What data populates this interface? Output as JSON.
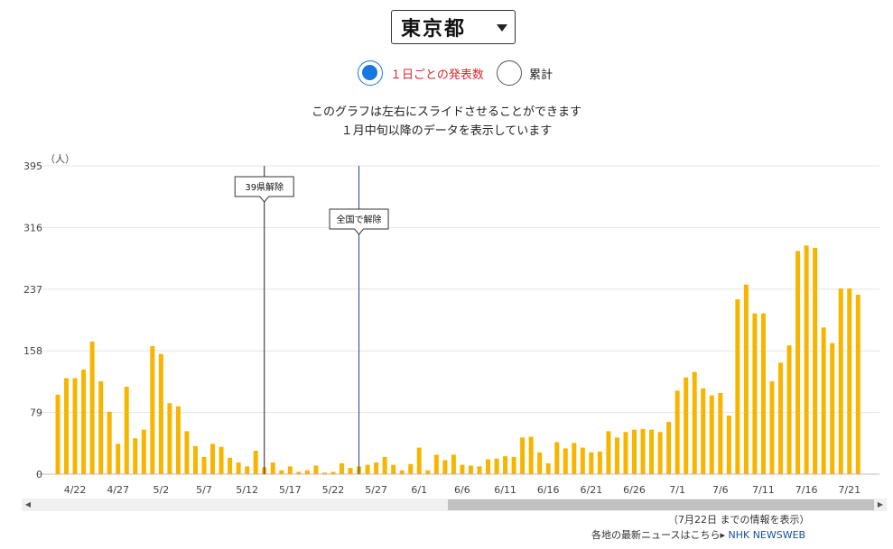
{
  "selector": {
    "value": "東京都"
  },
  "view_mode": {
    "options": [
      {
        "label": "１日ごとの発表数",
        "selected": true
      },
      {
        "label": "累計",
        "selected": false
      }
    ]
  },
  "notes": {
    "line1": "このグラフは左右にスライドさせることができます",
    "line2": "１月中旬以降のデータを表示しています"
  },
  "footer": {
    "info_date": "（7月22日 までの情報を表示）",
    "news_text": "各地の最新ニュースはこちら▸",
    "news_link": "NHK NEWSWEB"
  },
  "colors": {
    "bar": "#f8b500",
    "accent": "#1677e0",
    "selected_label": "#d9262c"
  },
  "chart_data": {
    "type": "bar",
    "unit_label": "（人）",
    "ylim": [
      0,
      395
    ],
    "yticks": [
      0,
      79,
      158,
      237,
      316,
      395
    ],
    "grid": true,
    "x": [
      "4/20",
      "4/21",
      "4/22",
      "4/23",
      "4/24",
      "4/25",
      "4/26",
      "4/27",
      "4/28",
      "4/29",
      "4/30",
      "5/1",
      "5/2",
      "5/3",
      "5/4",
      "5/5",
      "5/6",
      "5/7",
      "5/8",
      "5/9",
      "5/10",
      "5/11",
      "5/12",
      "5/13",
      "5/14",
      "5/15",
      "5/16",
      "5/17",
      "5/18",
      "5/19",
      "5/20",
      "5/21",
      "5/22",
      "5/23",
      "5/24",
      "5/25",
      "5/26",
      "5/27",
      "5/28",
      "5/29",
      "5/30",
      "5/31",
      "6/1",
      "6/2",
      "6/3",
      "6/4",
      "6/5",
      "6/6",
      "6/7",
      "6/8",
      "6/9",
      "6/10",
      "6/11",
      "6/12",
      "6/13",
      "6/14",
      "6/15",
      "6/16",
      "6/17",
      "6/18",
      "6/19",
      "6/20",
      "6/21",
      "6/22",
      "6/23",
      "6/24",
      "6/25",
      "6/26",
      "6/27",
      "6/28",
      "6/29",
      "6/30",
      "7/1",
      "7/2",
      "7/3",
      "7/4",
      "7/5",
      "7/6",
      "7/7",
      "7/8",
      "7/9",
      "7/10",
      "7/11",
      "7/12",
      "7/13",
      "7/14",
      "7/15",
      "7/16",
      "7/17",
      "7/18",
      "7/19",
      "7/20",
      "7/21",
      "7/22"
    ],
    "values": [
      102,
      123,
      123,
      134,
      170,
      119,
      80,
      39,
      112,
      46,
      57,
      164,
      154,
      91,
      87,
      55,
      36,
      22,
      39,
      35,
      21,
      15,
      10,
      30,
      9,
      15,
      5,
      10,
      3,
      5,
      11,
      2,
      3,
      14,
      8,
      10,
      12,
      15,
      22,
      12,
      5,
      13,
      34,
      5,
      25,
      18,
      25,
      12,
      11,
      10,
      19,
      20,
      23,
      22,
      47,
      48,
      28,
      14,
      41,
      33,
      40,
      34,
      28,
      29,
      55,
      47,
      54,
      57,
      58,
      57,
      54,
      67,
      107,
      124,
      131,
      110,
      101,
      104,
      75,
      224,
      243,
      206,
      206,
      119,
      143,
      165,
      286,
      293,
      290,
      188,
      168,
      238,
      238,
      230
    ],
    "x_labels": [
      "4/22",
      "4/27",
      "5/2",
      "5/7",
      "5/12",
      "5/17",
      "5/22",
      "5/27",
      "6/1",
      "6/6",
      "6/11",
      "6/16",
      "6/21",
      "6/26",
      "7/1",
      "7/6",
      "7/11",
      "7/16",
      "7/21"
    ],
    "annotations": [
      {
        "label": "39県解除",
        "date": "5/14",
        "line_color": "#222222"
      },
      {
        "label": "全国で解除",
        "date": "5/25",
        "line_color": "#2a3a8a"
      }
    ]
  }
}
